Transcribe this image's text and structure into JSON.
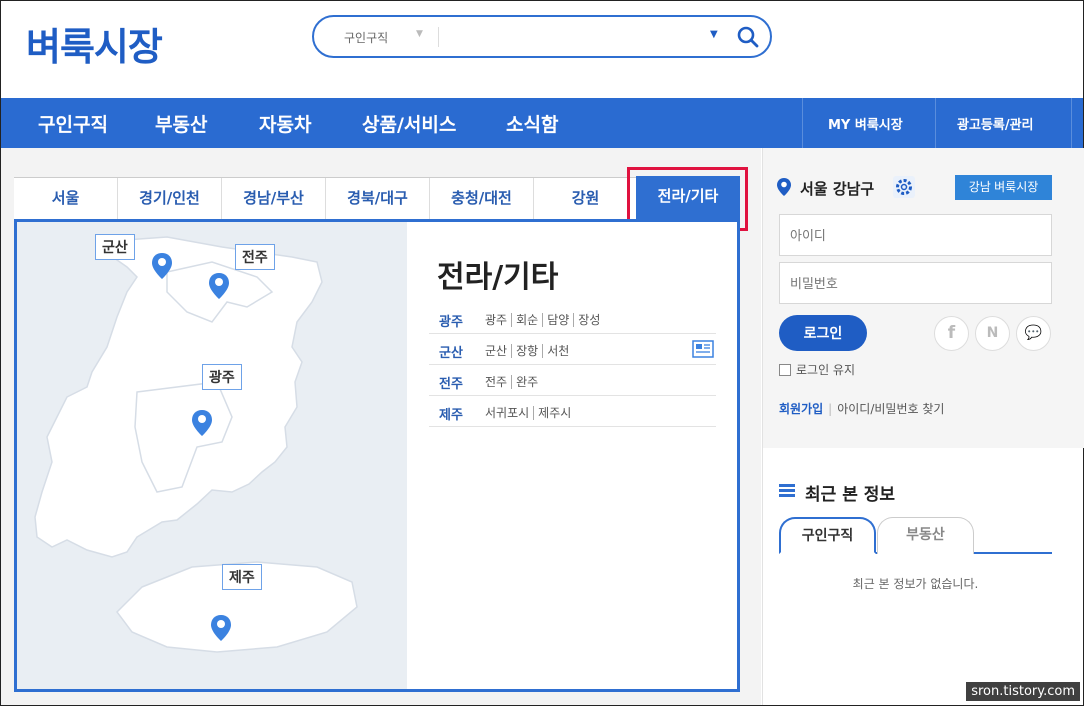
{
  "logo": "벼룩시장",
  "search": {
    "category": "구인구직",
    "placeholder": ""
  },
  "nav": {
    "items": [
      "구인구직",
      "부동산",
      "자동차",
      "상품/서비스",
      "소식함"
    ],
    "right": [
      "MY 벼룩시장",
      "광고등록/관리"
    ]
  },
  "region_tabs": [
    "서울",
    "경기/인천",
    "경남/부산",
    "경북/대구",
    "충청/대전",
    "강원",
    "전라/기타"
  ],
  "active_tab": "전라/기타",
  "map_labels": {
    "gunsan": "군산",
    "jeonju": "전주",
    "gwangju": "광주",
    "jeju": "제주"
  },
  "panel": {
    "title": "전라/기타",
    "rows": [
      {
        "key": "광주",
        "values": [
          "광주",
          "회순",
          "담양",
          "장성"
        ]
      },
      {
        "key": "군산",
        "values": [
          "군산",
          "장항",
          "서천"
        ]
      },
      {
        "key": "전주",
        "values": [
          "전주",
          "완주"
        ]
      },
      {
        "key": "제주",
        "values": [
          "서귀포시",
          "제주시"
        ]
      }
    ]
  },
  "sidebar": {
    "location": "서울 강남구",
    "local_button": "강남 벼룩시장",
    "id_placeholder": "아이디",
    "pw_placeholder": "비밀번호",
    "login_button": "로그인",
    "social": [
      "f",
      "N",
      "💬"
    ],
    "keep_login": "로그인 유지",
    "join": "회원가입",
    "find": "아이디/비밀번호 찾기",
    "recent_title": "최근 본 정보",
    "recent_tabs": [
      "구인구직",
      "부동산"
    ],
    "empty_text": "최근 본 정보가 없습니다."
  },
  "watermark": "sron.tistory.com",
  "colors": {
    "brand": "#1f5dc4",
    "nav": "#2a6bd1",
    "highlight": "#e0123f"
  }
}
